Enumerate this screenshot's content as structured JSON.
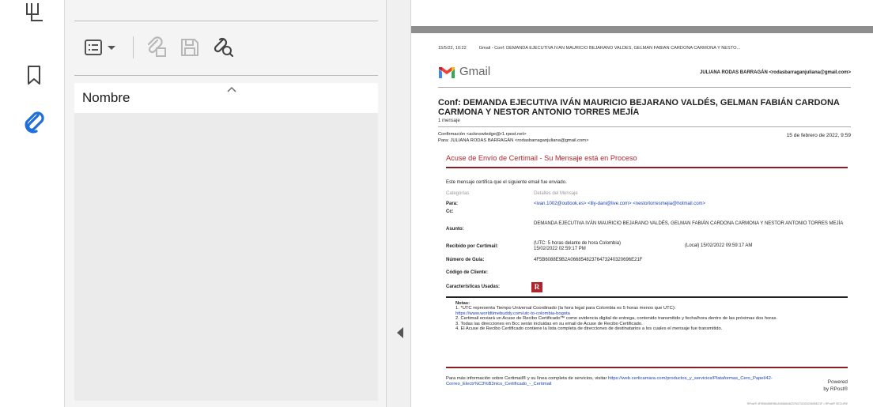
{
  "rail": {
    "items": [
      {
        "icon": "copy-pages-icon"
      },
      {
        "icon": "bookmark-icon"
      },
      {
        "icon": "paperclip-icon",
        "active": true
      }
    ]
  },
  "attachments_panel": {
    "column_header": "Nombre",
    "toolbar": [
      "options-menu-icon",
      "open-attachment-icon",
      "save-attachment-icon",
      "search-attachment-icon"
    ]
  },
  "document": {
    "header_date": "15/5/22, 10:22",
    "header_title": "Gmail - Conf: DEMANDA EJECUTIVA IVÁN MAURICIO BEJARANO VALDÉS, GELMAN FABIÁN CARDONA CARMONA Y NESTO...",
    "gmail_word": "Gmail",
    "gmail_user": "JULIANA RODAS BARRAGÁN <rodasbarraganjuliana@gmail.com>",
    "subject": "Conf: DEMANDA EJECUTIVA IVÁN MAURICIO BEJARANO VALDÉS, GELMAN FABIÁN CARDONA CARMONA Y NESTOR ANTONIO TORRES MEJÍA",
    "message_count": "1 mensaje",
    "from": "Confirmación <acknowledge@r1.rpost.net>",
    "to": "Para: JULIANA RODAS BARRAGÁN <rodasbarraganjuliana@gmail.com>",
    "date": "15 de febrero de 2022, 9:59",
    "acuse_title": "Acuse de Envío de Certimail - Su Mensaje está en Proceso",
    "cert_text": "Este mensaje certifica que el siguiente email fue enviado.",
    "col_categories": "Categorías",
    "col_details": "Detalles del Mensaje",
    "para_label": "Para:",
    "para_value": "<ivan.1002@outlook.es> <lily-dani@live.com> <nestortorresmejia@hotmail.com>",
    "cc_label": "Cc:",
    "asunto_label": "Asunto:",
    "asunto_value": "DEMANDA EJECUTIVA IVÁN MAURICIO BEJARANO VALDÉS, GELMAN FABIÁN CARDONA CARMONA Y NESTOR ANTONIO TORRES MEJÍA",
    "recibido_label": "Recibido por Certimail:",
    "recibido_utc": "(UTC: 5 horas delante de hora Colombia)",
    "recibido_utc_time": "15/02/2022 02:59:17 PM",
    "recibido_local": "(Local) 15/02/2022 09:59:17 AM",
    "guia_label": "Número de Guía:",
    "guia_value": "4F5B6088E9B2A06685482376473240320696E21F",
    "cliente_label": "Código de Cliente:",
    "caract_label": "Características Usadas:",
    "caract_badge": "R",
    "notes_title": "Notas:",
    "note1": "1. *UTC representa Tiempo Universal Coordinado (la hora legal para Colombia es 5 horas menos que UTC):",
    "note1_link": "https://www.worldtimebuddy.com/utc-to-colombia-bogota",
    "note2": "2. Certimail enviará un Acuse de Recibo Certificado™ como evidencia digital de entrega, contenido transmitido y fecha/hora dentro de las próximas dos horas.",
    "note3": "3. Todas las direcciones en Bcc serán incluidas en su email de Acuse de Recibo Certificado.",
    "note4": "4. El Acuse de Recibo Certificado contiene la lista completa de direcciones de destinatarios a los cuales el mensaje fue transmitido.",
    "footer_text": "Para más información sobre Certimail® y su línea completa de servicios, visitar ",
    "footer_link": "https://web.certicamara.com/productos_y_servicios/Plataformas_Cero_Papel/42-Correo_Electr%C3%B3nico_Certificado_-_Certimail",
    "powered_1": "Powered",
    "powered_2": "by RPost®",
    "small_url": "RPost® 4F5B6088E9B2A06685482376473240320696E21F • RPost® SECURE"
  },
  "colors": {
    "accent_red": "#b0262c",
    "link_blue": "#1a3fb6",
    "paperclip_blue": "#1e6fd9"
  }
}
